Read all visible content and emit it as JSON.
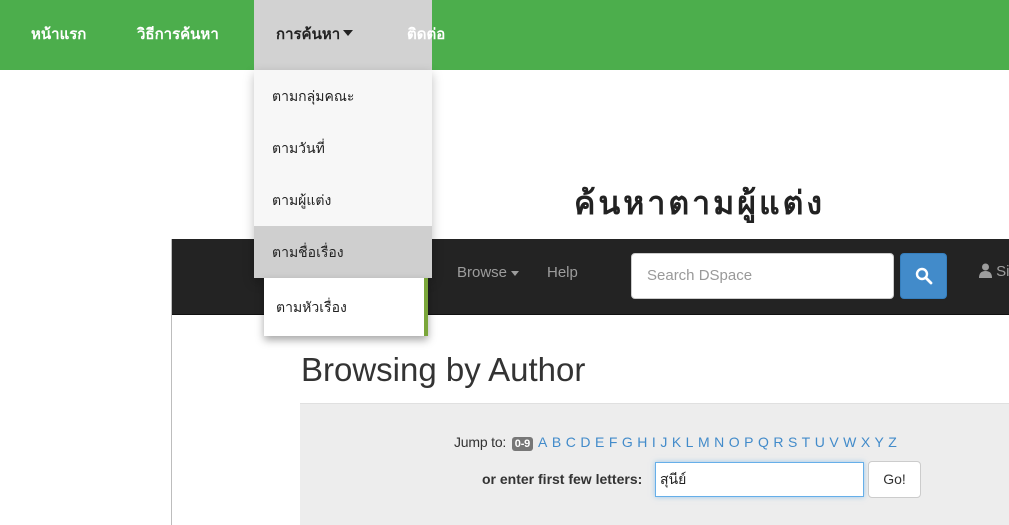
{
  "topnav": {
    "home": "หน้าแรก",
    "howto": "วิธีการค้นหา",
    "search": "การค้นหา",
    "contact": "ติดต่อ"
  },
  "dropdown": {
    "items": [
      "ตามกลุ่มคณะ",
      "ตามวันที่",
      "ตามผู้แต่ง",
      "ตามชื่อเรื่อง"
    ],
    "submenu": "ตามหัวเรื่อง"
  },
  "heading": "ค้นหาตามผู้แต่ง",
  "dspace": {
    "navbar": {
      "browse": "Browse",
      "help": "Help",
      "search_placeholder": "Search DSpace",
      "signin_fragment": "Si"
    },
    "title": "Browsing by Author",
    "jump": {
      "label": "Jump to:",
      "digits_badge": "0-9",
      "letters": [
        "A",
        "B",
        "C",
        "D",
        "E",
        "F",
        "G",
        "H",
        "I",
        "J",
        "K",
        "L",
        "M",
        "N",
        "O",
        "P",
        "Q",
        "R",
        "S",
        "T",
        "U",
        "V",
        "W",
        "X",
        "Y",
        "Z"
      ]
    },
    "enter_label": "or enter first few letters:",
    "input_value": "สุนีย์",
    "go": "Go!"
  },
  "colors": {
    "nav_green": "#4cae4c",
    "dspace_dark": "#232323",
    "link_blue": "#428bca"
  }
}
